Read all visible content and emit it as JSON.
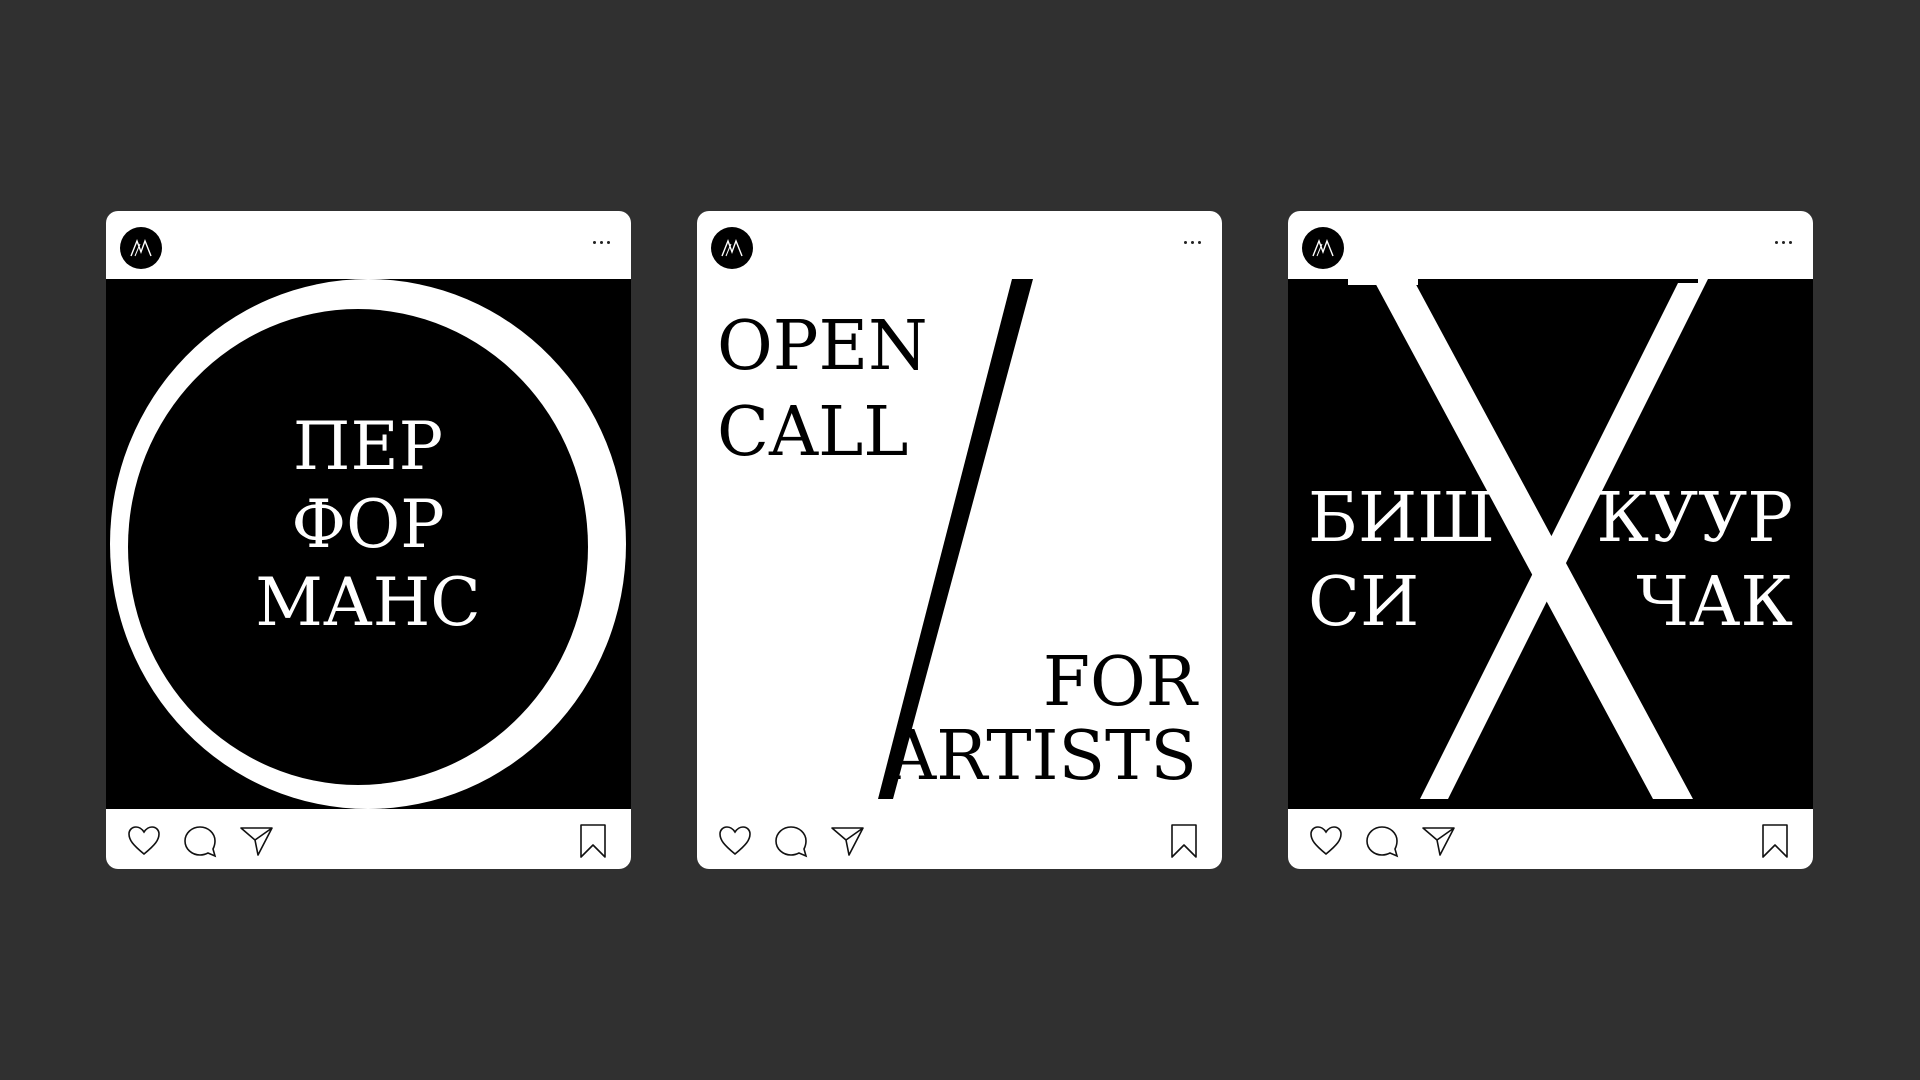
{
  "colors": {
    "background": "#303030",
    "card": "#ffffff",
    "ink": "#000000"
  },
  "posts": [
    {
      "avatar_icon": "monogram-icon",
      "image": {
        "glyph": "O",
        "lines": [
          "ПЕР",
          "ФОР",
          "МАНС"
        ]
      }
    },
    {
      "avatar_icon": "monogram-icon",
      "image": {
        "top_lines": [
          "OPEN",
          "CALL"
        ],
        "bottom_lines": [
          "FOR",
          "ARTISTS"
        ]
      }
    },
    {
      "avatar_icon": "monogram-icon",
      "image": {
        "glyph": "X",
        "left_lines": [
          "БИШ",
          "СИ"
        ],
        "right_lines": [
          "КУУР",
          "ЧАК"
        ]
      }
    }
  ],
  "actions": [
    "heart-icon",
    "comment-icon",
    "send-icon",
    "bookmark-icon"
  ]
}
